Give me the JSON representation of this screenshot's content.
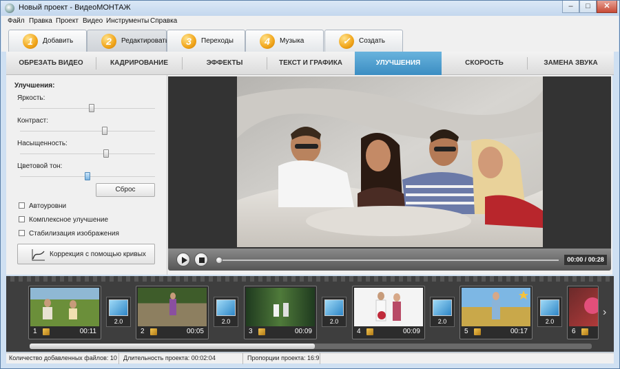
{
  "window": {
    "title": "Новый проект - ВидеоМОНТАЖ",
    "min": "–",
    "max": "□",
    "close": "✕"
  },
  "menu": [
    "Файл",
    "Правка",
    "Проект",
    "Видео",
    "Инструменты",
    "Справка"
  ],
  "steps": [
    {
      "num": "1",
      "label": "Добавить"
    },
    {
      "num": "2",
      "label": "Редактировать"
    },
    {
      "num": "3",
      "label": "Переходы"
    },
    {
      "num": "4",
      "label": "Музыка"
    },
    {
      "num": "✓",
      "label": "Создать"
    }
  ],
  "subtabs": [
    "ОБРЕЗАТЬ ВИДЕО",
    "КАДРИРОВАНИЕ",
    "ЭФФЕКТЫ",
    "ТЕКСТ И ГРАФИКА",
    "УЛУЧШЕНИЯ",
    "СКОРОСТЬ",
    "ЗАМЕНА ЗВУКА"
  ],
  "panel": {
    "title": "Улучшения:",
    "sliders": [
      {
        "label": "Яркость:",
        "value": 0.53
      },
      {
        "label": "Контраст:",
        "value": 0.63
      },
      {
        "label": "Насыщенность:",
        "value": 0.64
      },
      {
        "label": "Цветовой тон:",
        "value": 0.5
      }
    ],
    "reset": "Сброс",
    "checkboxes": [
      "Автоуровни",
      "Комплексное улучшение",
      "Стабилизация изображения"
    ],
    "curves": "Коррекция с помощью кривых"
  },
  "player": {
    "time": "00:00 / 00:28",
    "progress": 0.0
  },
  "clips": [
    {
      "num": "1",
      "dur": "00:11"
    },
    {
      "num": "2",
      "dur": "00:05"
    },
    {
      "num": "3",
      "dur": "00:09"
    },
    {
      "num": "4",
      "dur": "00:09"
    },
    {
      "num": "5",
      "dur": "00:17"
    },
    {
      "num": "6",
      "dur": ""
    }
  ],
  "transitions": [
    "2.0",
    "2.0",
    "2.0",
    "2.0",
    "2.0"
  ],
  "status": {
    "files": "Количество добавленных файлов: 10",
    "duration": "Длительность проекта: 00:02:04",
    "ratio": "Пропорции проекта: 16:9"
  }
}
